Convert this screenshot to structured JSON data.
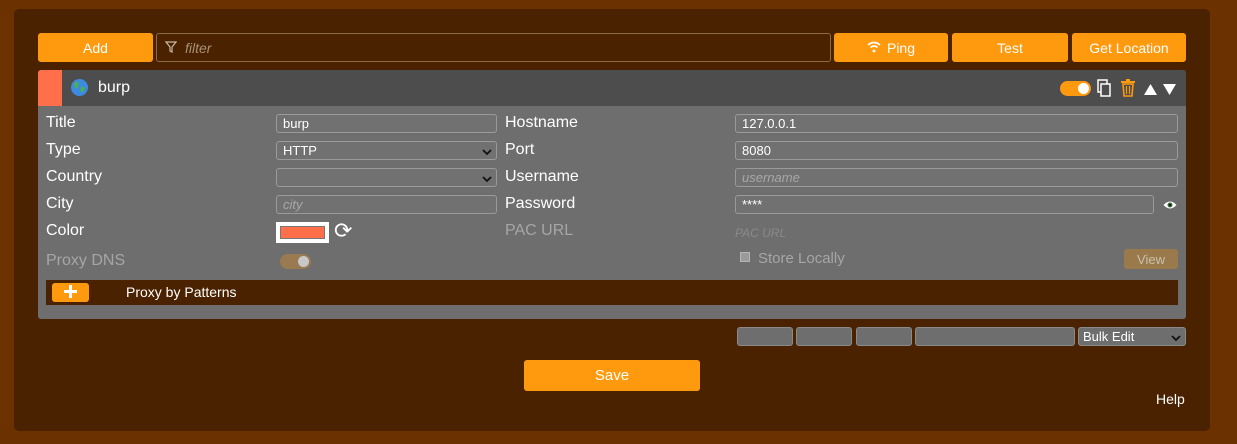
{
  "toolbar": {
    "add_label": "Add",
    "filter_placeholder": "filter",
    "ping_label": "Ping",
    "test_label": "Test",
    "get_location_label": "Get Location"
  },
  "proxy": {
    "name": "burp",
    "color": "#ff6f4a",
    "enabled": true,
    "fields": {
      "title_label": "Title",
      "title_value": "burp",
      "type_label": "Type",
      "type_value": "HTTP",
      "country_label": "Country",
      "country_value": "",
      "city_label": "City",
      "city_placeholder": "city",
      "color_label": "Color",
      "proxy_dns_label": "Proxy DNS",
      "hostname_label": "Hostname",
      "hostname_value": "127.0.0.1",
      "port_label": "Port",
      "port_value": "8080",
      "username_label": "Username",
      "username_placeholder": "username",
      "password_label": "Password",
      "password_value": "****",
      "pac_url_label": "PAC URL",
      "pac_url_placeholder": "PAC URL",
      "store_locally_label": "Store Locally",
      "view_label": "View"
    },
    "patterns_label": "Proxy by Patterns"
  },
  "bulk": {
    "select_value": "Bulk Edit"
  },
  "footer": {
    "save_label": "Save",
    "help_label": "Help"
  },
  "colors": {
    "accent": "#ff9a0f",
    "background": "#6b3200",
    "panel": "#4a2200",
    "card": "#6e6e6e",
    "card_header": "#4d4d4d"
  },
  "icons": [
    "filter-icon",
    "wifi-icon",
    "globe-icon",
    "copy-icon",
    "trash-icon",
    "move-up-icon",
    "move-down-icon",
    "refresh-icon",
    "eye-icon",
    "plus-icon",
    "chevron-down-icon"
  ]
}
